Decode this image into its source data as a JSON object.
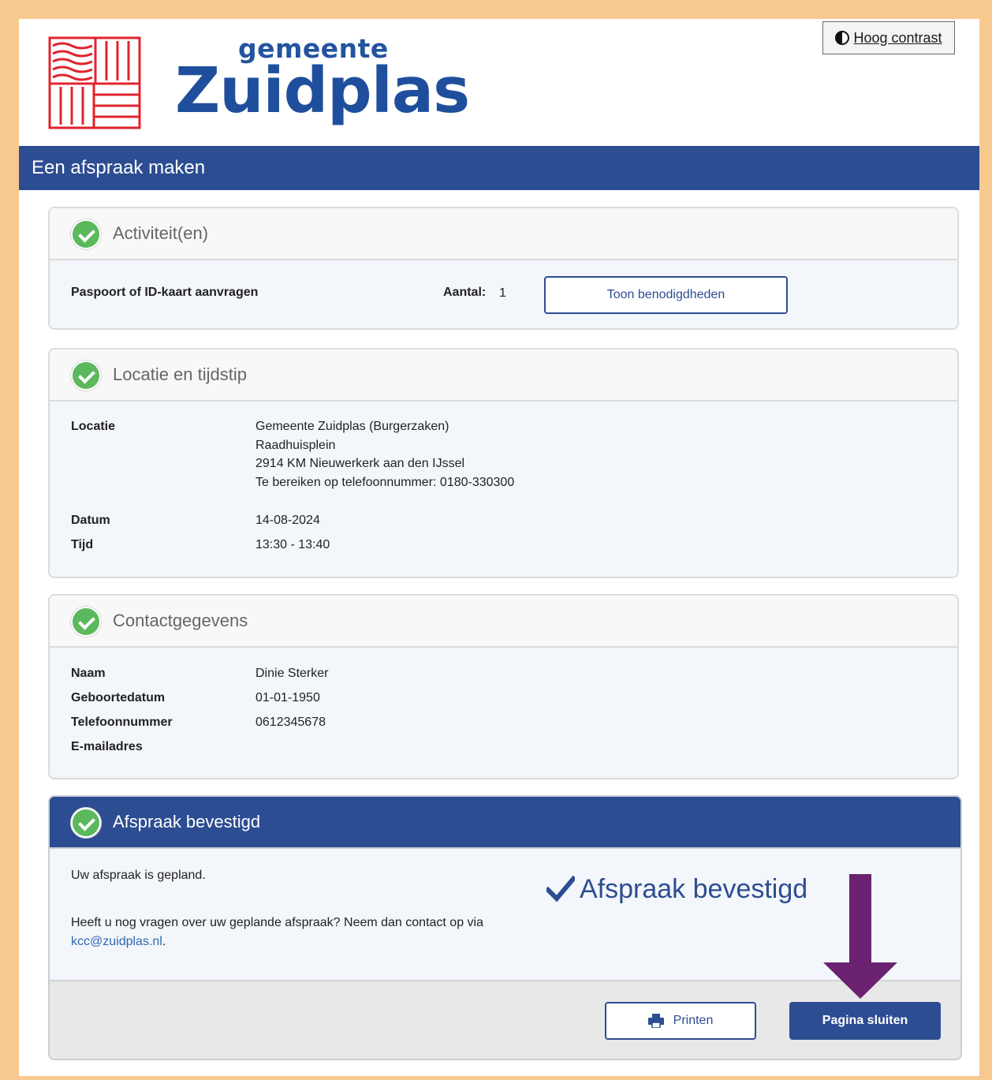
{
  "brand": {
    "small": "gemeente",
    "big": "Zuidplas"
  },
  "header": {
    "contrast_label": "Hoog contrast"
  },
  "page": {
    "title": "Een afspraak maken"
  },
  "activities": {
    "title": "Activiteit(en)",
    "item": "Paspoort of ID-kaart aanvragen",
    "count_label": "Aantal:",
    "count_value": "1",
    "button_label": "Toon benodigdheden"
  },
  "location": {
    "title": "Locatie en tijdstip",
    "location_label": "Locatie",
    "location_lines": [
      "Gemeente Zuidplas (Burgerzaken)",
      "Raadhuisplein",
      "2914 KM Nieuwerkerk aan den IJssel",
      "Te bereiken op telefoonnummer: 0180-330300"
    ],
    "date_label": "Datum",
    "date_value": "14-08-2024",
    "time_label": "Tijd",
    "time_value": "13:30 - 13:40"
  },
  "contact": {
    "title": "Contactgegevens",
    "name_label": "Naam",
    "name_value": "Dinie Sterker",
    "birth_label": "Geboortedatum",
    "birth_value": "01-01-1950",
    "phone_label": "Telefoonnummer",
    "phone_value": "0612345678",
    "email_label": "E-mailadres",
    "email_value": ""
  },
  "confirmation": {
    "title": "Afspraak bevestigd",
    "scheduled_text": "Uw afspraak is gepland.",
    "questions_text": "Heeft u nog vragen over uw geplande afspraak? Neem dan contact op via",
    "email_link": "kcc@zuidplas.nl",
    "email_suffix": ".",
    "big_message": "Afspraak bevestigd",
    "print_label": "Printen",
    "close_label": "Pagina sluiten"
  },
  "colors": {
    "primary": "#2d4d92",
    "success": "#5cb85c",
    "arrow": "#6b2270",
    "frame": "#f7c98f",
    "logo_red": "#e0242e"
  }
}
